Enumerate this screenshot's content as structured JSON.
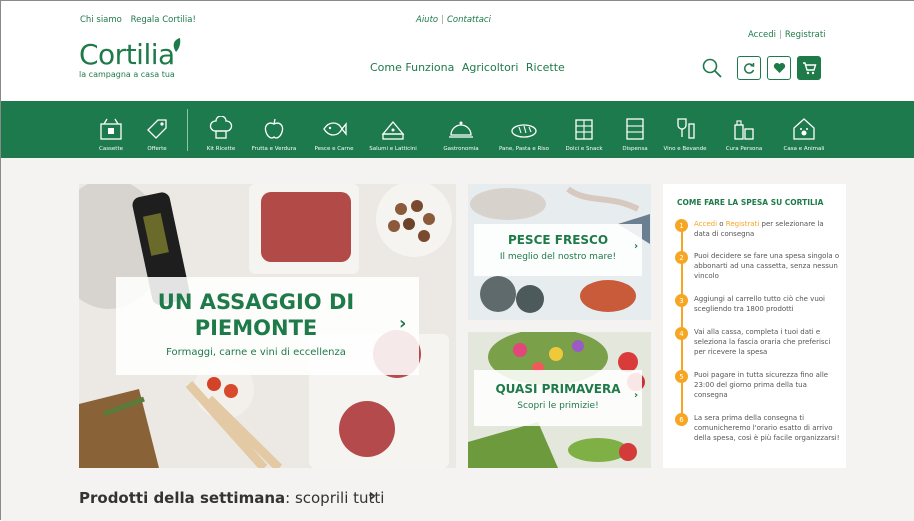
{
  "top_links": {
    "left": [
      "Chi siamo",
      "Regala Cortilia!"
    ],
    "help": "Aiuto",
    "contact": "Contattaci",
    "login": "Accedi",
    "register": "Registrati"
  },
  "logo": {
    "name": "Cortilia",
    "tagline": "la campagna a casa tua"
  },
  "main_nav": [
    "Come Funziona",
    "Agricoltori",
    "Ricette"
  ],
  "categories": [
    {
      "label": "Cassette",
      "icon": "crate-icon"
    },
    {
      "label": "Offerte",
      "icon": "price-tag-icon"
    },
    {
      "label": "Kit Ricette",
      "icon": "chef-hat-icon"
    },
    {
      "label": "Frutta e Verdura",
      "icon": "apple-icon"
    },
    {
      "label": "Pesce e Carne",
      "icon": "fish-icon"
    },
    {
      "label": "Salumi e Latticini",
      "icon": "cheese-icon"
    },
    {
      "label": "Gastronomia",
      "icon": "cloche-icon"
    },
    {
      "label": "Pane, Pasta e Riso",
      "icon": "bread-icon"
    },
    {
      "label": "Dolci e Snack",
      "icon": "chocolate-icon"
    },
    {
      "label": "Dispensa",
      "icon": "pantry-icon"
    },
    {
      "label": "Vino e Bevande",
      "icon": "wine-icon"
    },
    {
      "label": "Cura Persona",
      "icon": "bottle-icon"
    },
    {
      "label": "Casa e Animali",
      "icon": "pet-house-icon"
    }
  ],
  "hero": {
    "title_line1": "UN ASSAGGIO DI",
    "title_line2": "PIEMONTE",
    "subtitle": "Formaggi, carne e vini di eccellenza"
  },
  "tile_fish": {
    "title": "PESCE FRESCO",
    "subtitle": "Il meglio del nostro mare!"
  },
  "tile_spring": {
    "title": "QUASI PRIMAVERA",
    "subtitle": "Scopri le primizie!"
  },
  "howto": {
    "title": "COME FARE LA SPESA SU CORTILIA",
    "steps": [
      {
        "num": "1",
        "a": "Accedi",
        "b": " o ",
        "c": "Registrati",
        "d": " per selezionare la data di consegna"
      },
      {
        "num": "2",
        "text": "Puoi decidere se fare una spesa singola o abbonarti ad una cassetta, senza nessun vincolo"
      },
      {
        "num": "3",
        "text": "Aggiungi al carrello tutto ciò che vuoi scegliendo tra 1800 prodotti"
      },
      {
        "num": "4",
        "text": "Vai alla cassa, completa i tuoi dati e seleziona la fascia oraria che preferisci per ricevere la spesa"
      },
      {
        "num": "5",
        "text": "Puoi pagare in tutta sicurezza fino alle 23:00 del giorno prima della tua consegna"
      },
      {
        "num": "6",
        "text": "La sera prima della consegna ti comunicheremo l'orario esatto di arrivo della spesa, così è più facile organizzarsi!"
      }
    ]
  },
  "products": {
    "bold": "Prodotti della settimana",
    "rest": ": scoprili tutti"
  },
  "colors": {
    "brand_green": "#1d7a4d",
    "accent_orange": "#f6a623"
  }
}
